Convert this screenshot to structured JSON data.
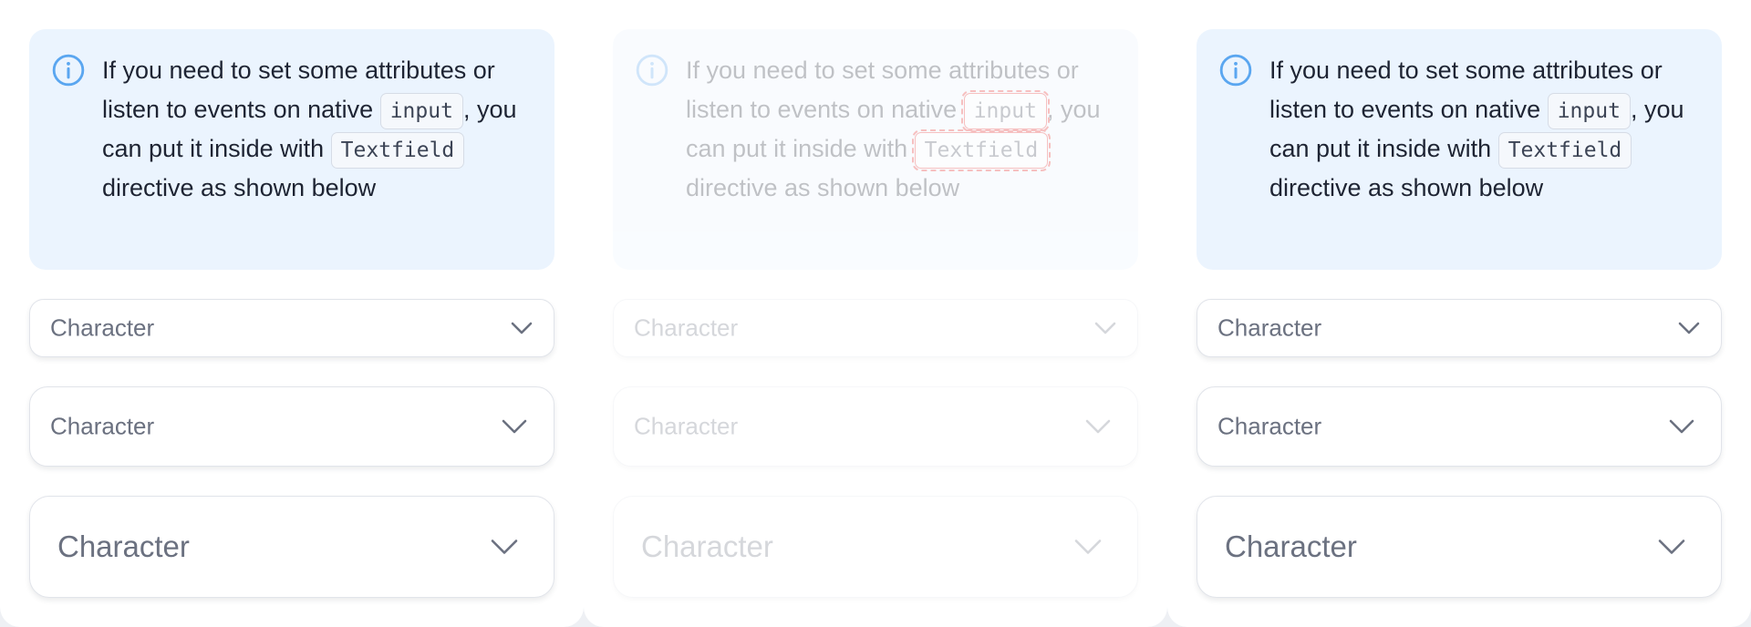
{
  "info": {
    "part1": "If you need to set some attributes or listen to events on native",
    "code1": "input",
    "part2": ", you can put it inside with",
    "code2": "Textfield",
    "part3": "directive as shown below",
    "icon": "info-circle-icon"
  },
  "selects": {
    "small": {
      "value": "Character",
      "icon": "chevron-down-icon"
    },
    "medium": {
      "value": "Character",
      "icon": "chevron-down-icon"
    },
    "large": {
      "value": "Character",
      "icon": "chevron-down-icon"
    }
  },
  "colors": {
    "info_bg": "#ebf4fe",
    "info_icon": "#5aa6f0",
    "text": "#1e2433",
    "muted": "#6b7180",
    "highlight": "#e02020"
  }
}
